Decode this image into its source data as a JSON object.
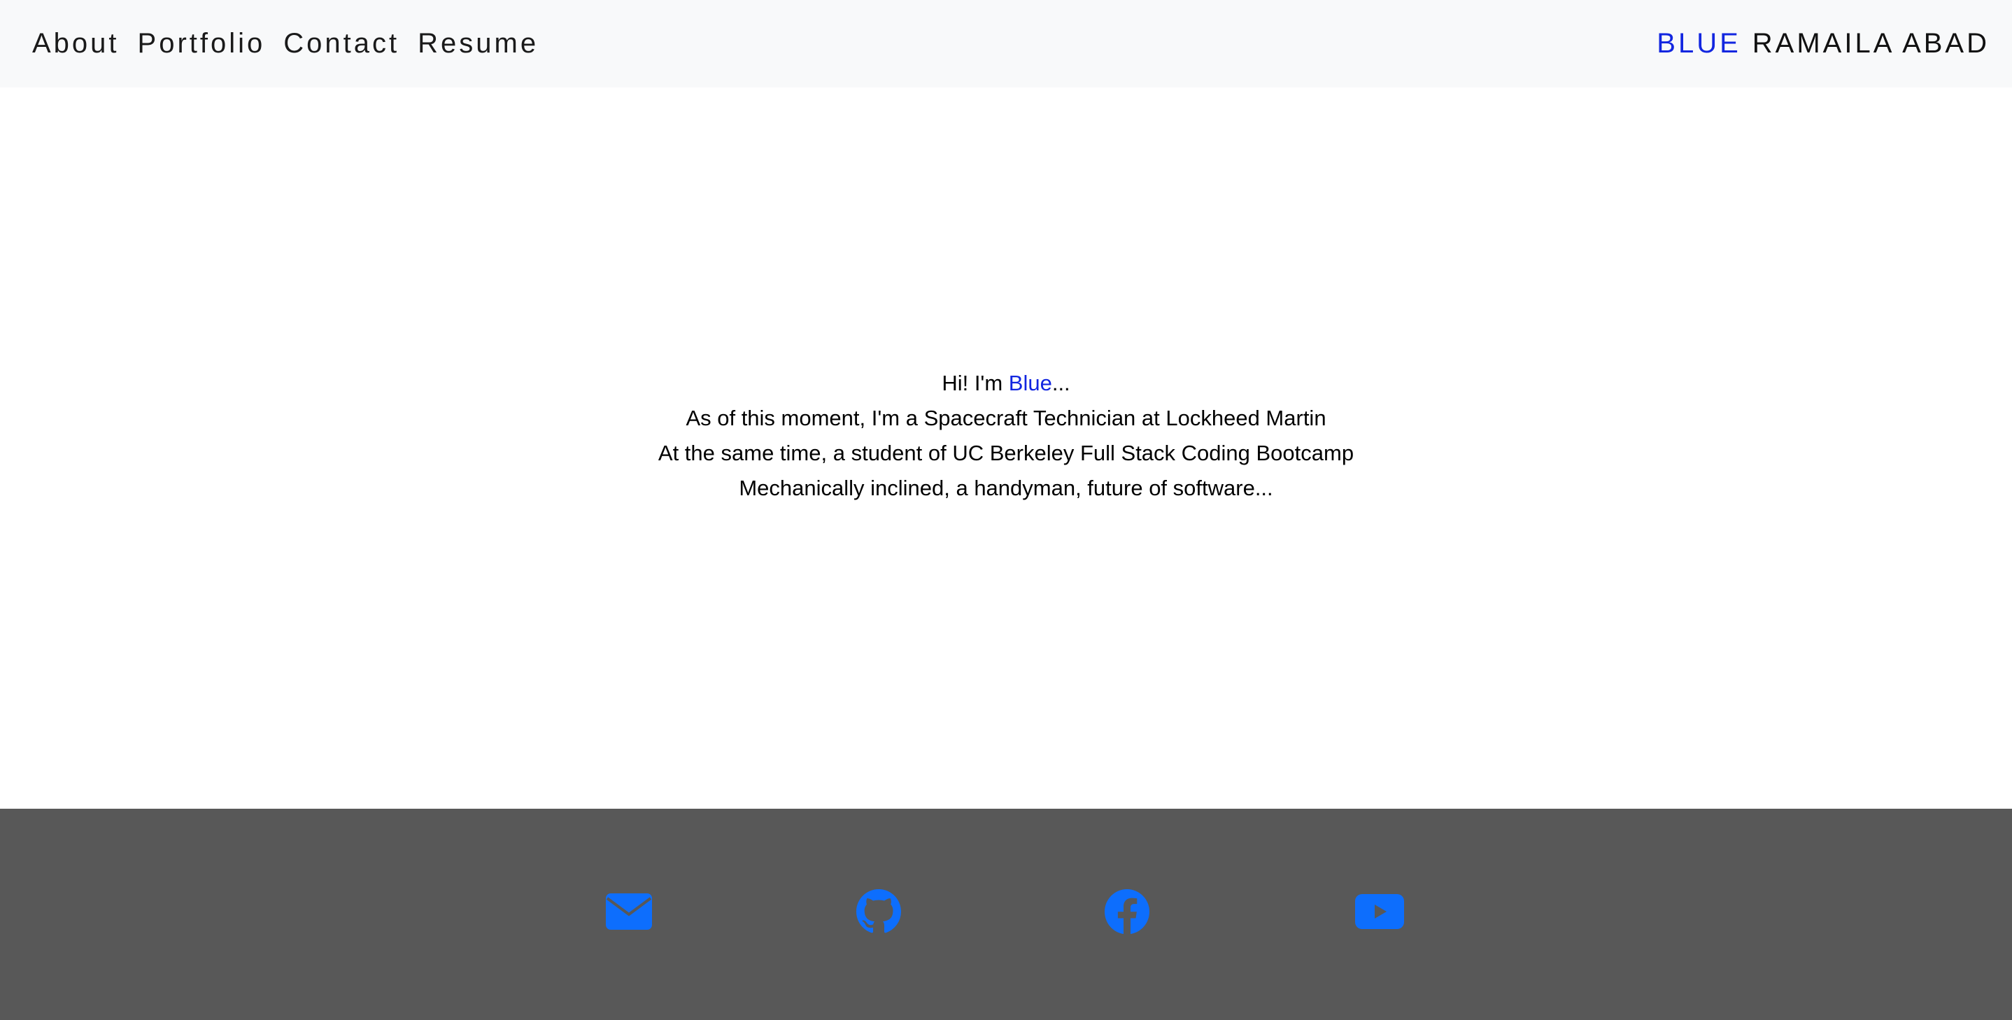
{
  "nav": {
    "links": [
      {
        "label": "About"
      },
      {
        "label": "Portfolio"
      },
      {
        "label": "Contact"
      },
      {
        "label": "Resume"
      }
    ]
  },
  "brand": {
    "first": "BLUE",
    "last": "RAMAILA ABAD"
  },
  "intro": {
    "greeting_prefix": "Hi! I'm ",
    "greeting_name": "Blue",
    "greeting_suffix": "...",
    "line2": "As of this moment, I'm a Spacecraft Technician at Lockheed Martin",
    "line3": "At the same time, a student of UC Berkeley Full Stack Coding Bootcamp",
    "line4": "Mechanically inclined, a handyman, future of software..."
  },
  "footer": {
    "icons": [
      "envelope-icon",
      "github-icon",
      "facebook-icon",
      "youtube-icon"
    ]
  },
  "colors": {
    "accent": "#1226e0",
    "icon": "#0d6efd",
    "navbar_bg": "#f8f9fa",
    "footer_bg": "#585858"
  }
}
